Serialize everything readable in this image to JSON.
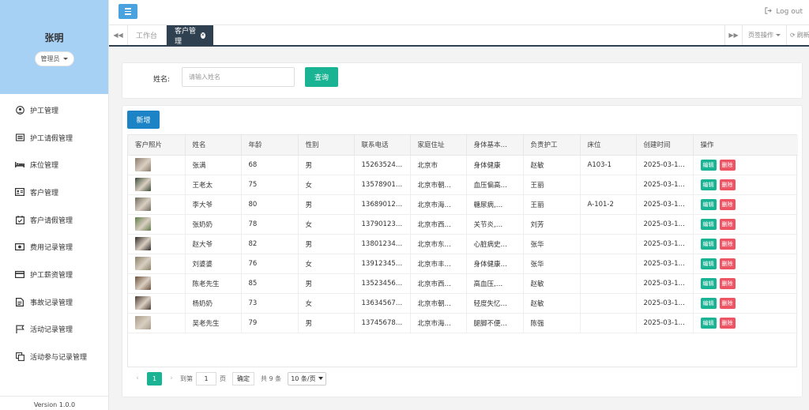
{
  "sidebar": {
    "user_name": "张明",
    "role": "管理员",
    "items": [
      {
        "label": "护工管理",
        "icon": "user-circle-icon"
      },
      {
        "label": "护工请假管理",
        "icon": "list-icon"
      },
      {
        "label": "床位管理",
        "icon": "bed-icon"
      },
      {
        "label": "客户管理",
        "icon": "id-card-icon"
      },
      {
        "label": "客户请假管理",
        "icon": "calendar-check-icon"
      },
      {
        "label": "费用记录管理",
        "icon": "money-icon"
      },
      {
        "label": "护工薪资管理",
        "icon": "credit-card-icon"
      },
      {
        "label": "事故记录管理",
        "icon": "file-icon"
      },
      {
        "label": "活动记录管理",
        "icon": "flag-icon"
      },
      {
        "label": "活动参与记录管理",
        "icon": "copy-icon"
      }
    ],
    "version": "Version 1.0.0"
  },
  "topbar": {
    "logout_label": "Log out"
  },
  "tabs": {
    "items": [
      {
        "label": "工作台",
        "active": false
      },
      {
        "label": "客户管理",
        "active": true
      }
    ],
    "ops_label": "页签操作",
    "refresh_label": "刷新"
  },
  "search": {
    "label": "姓名:",
    "placeholder": "请输入姓名",
    "value": "",
    "button": "查询"
  },
  "table": {
    "add_button": "新增",
    "columns": [
      "客户照片",
      "姓名",
      "年龄",
      "性别",
      "联系电话",
      "家庭住址",
      "身体基本…",
      "负责护工",
      "床位",
      "创建时间",
      "操作"
    ],
    "edit_label": "编辑",
    "delete_label": "删除",
    "rows": [
      {
        "photo_color": "#8b7a6a",
        "name": "张满",
        "age": "68",
        "gender": "男",
        "phone": "15263524…",
        "address": "北京市",
        "health": "身体健康",
        "nurse": "赵敏",
        "bed": "A103-1",
        "created": "2025-03-1…"
      },
      {
        "photo_color": "#3b4a36",
        "name": "王老太",
        "age": "75",
        "gender": "女",
        "phone": "13578901…",
        "address": "北京市朝…",
        "health": "血压偏高…",
        "nurse": "王丽",
        "bed": "",
        "created": "2025-03-1…"
      },
      {
        "photo_color": "#6e6a5c",
        "name": "李大爷",
        "age": "80",
        "gender": "男",
        "phone": "13689012…",
        "address": "北京市海…",
        "health": "糖尿病,…",
        "nurse": "王丽",
        "bed": "A-101-2",
        "created": "2025-03-1…"
      },
      {
        "photo_color": "#5f7a46",
        "name": "张奶奶",
        "age": "78",
        "gender": "女",
        "phone": "13790123…",
        "address": "北京市西…",
        "health": "关节炎,…",
        "nurse": "刘芳",
        "bed": "",
        "created": "2025-03-1…"
      },
      {
        "photo_color": "#2f2a26",
        "name": "赵大爷",
        "age": "82",
        "gender": "男",
        "phone": "13801234…",
        "address": "北京市东…",
        "health": "心脏病史…",
        "nurse": "张华",
        "bed": "",
        "created": "2025-03-1…"
      },
      {
        "photo_color": "#8a7f66",
        "name": "刘婆婆",
        "age": "76",
        "gender": "女",
        "phone": "13912345…",
        "address": "北京市丰…",
        "health": "身体健康…",
        "nurse": "张华",
        "bed": "",
        "created": "2025-03-1…"
      },
      {
        "photo_color": "#6b4f3a",
        "name": "陈老先生",
        "age": "85",
        "gender": "男",
        "phone": "13523456…",
        "address": "北京市西…",
        "health": "高血压,…",
        "nurse": "赵敏",
        "bed": "",
        "created": "2025-03-1…"
      },
      {
        "photo_color": "#4d3a30",
        "name": "杨奶奶",
        "age": "73",
        "gender": "女",
        "phone": "13634567…",
        "address": "北京市朝…",
        "health": "轻度失忆…",
        "nurse": "赵敏",
        "bed": "",
        "created": "2025-03-1…"
      },
      {
        "photo_color": "#a89a88",
        "name": "吴老先生",
        "age": "79",
        "gender": "男",
        "phone": "13745678…",
        "address": "北京市海…",
        "health": "腿脚不便…",
        "nurse": "陈强",
        "bed": "",
        "created": "2025-03-1…"
      }
    ]
  },
  "pagination": {
    "current_page": "1",
    "goto_label": "到第",
    "page_input": "1",
    "page_suffix": "页",
    "confirm_label": "确定",
    "total_label": "共 9 条",
    "page_size": "10 条/页"
  },
  "colors": {
    "primary_green": "#1ab394",
    "primary_blue": "#1c84c6",
    "danger_red": "#ed5565",
    "sidebar_profile_bg": "#a7d0f5",
    "tab_active_bg": "#2f4050"
  }
}
